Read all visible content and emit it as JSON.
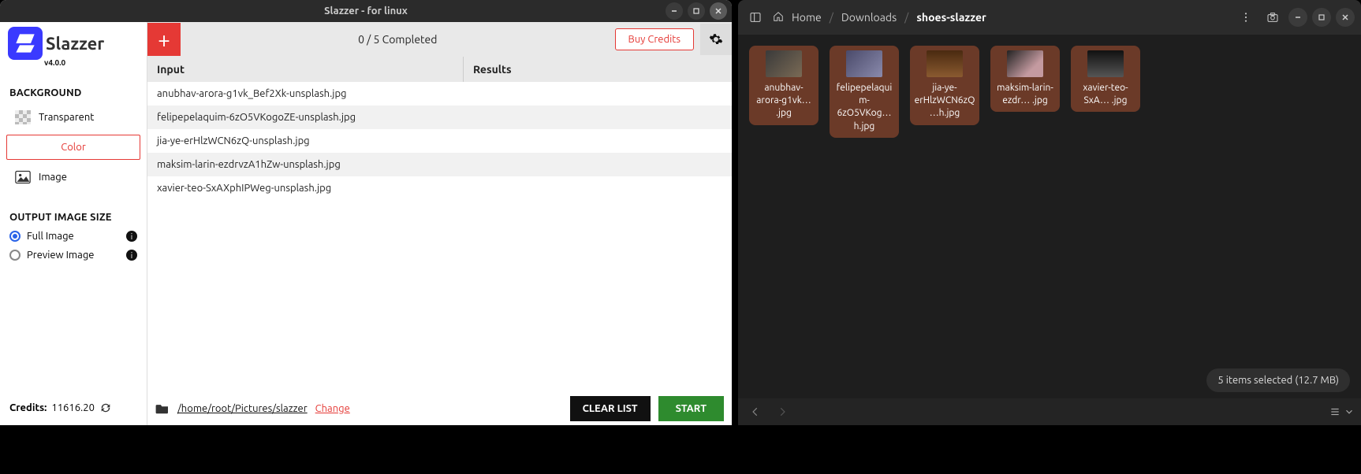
{
  "slazzer": {
    "window_title": "Slazzer - for linux",
    "logo_text": "Slazzer",
    "version": "v4.0.0",
    "background_title": "BACKGROUND",
    "bg_options": {
      "transparent": "Transparent",
      "color": "Color",
      "image": "Image"
    },
    "size_title": "OUTPUT IMAGE SIZE",
    "size_full": "Full Image",
    "size_preview": "Preview Image",
    "credits_label": "Credits:",
    "credits_value": "11616.20",
    "progress": "0 / 5 Completed",
    "buy_credits": "Buy Credits",
    "col_input": "Input",
    "col_results": "Results",
    "files": [
      "anubhav-arora-g1vk_Bef2Xk-unsplash.jpg",
      "felipepelaquim-6zO5VKogoZE-unsplash.jpg",
      "jia-ye-erHlzWCN6zQ-unsplash.jpg",
      "maksim-larin-ezdrvzA1hZw-unsplash.jpg",
      "xavier-teo-SxAXphIPWeg-unsplash.jpg"
    ],
    "output_path": "/home/root/Pictures/slazzer",
    "change": "Change",
    "clear": "CLEAR LIST",
    "start": "START"
  },
  "fm": {
    "crumbs": {
      "home": "Home",
      "downloads": "Downloads",
      "current": "shoes-slazzer"
    },
    "thumbs": [
      "anubhav-arora-g1vk… .jpg",
      "felipepelaquim-6zO5VKog…h.jpg",
      "jia-ye-erHlzWCN6zQ…h.jpg",
      "maksim-larin-ezdr… .jpg",
      "xavier-teo-SxA… .jpg"
    ],
    "status": "5 items selected  (12.7 MB)"
  }
}
